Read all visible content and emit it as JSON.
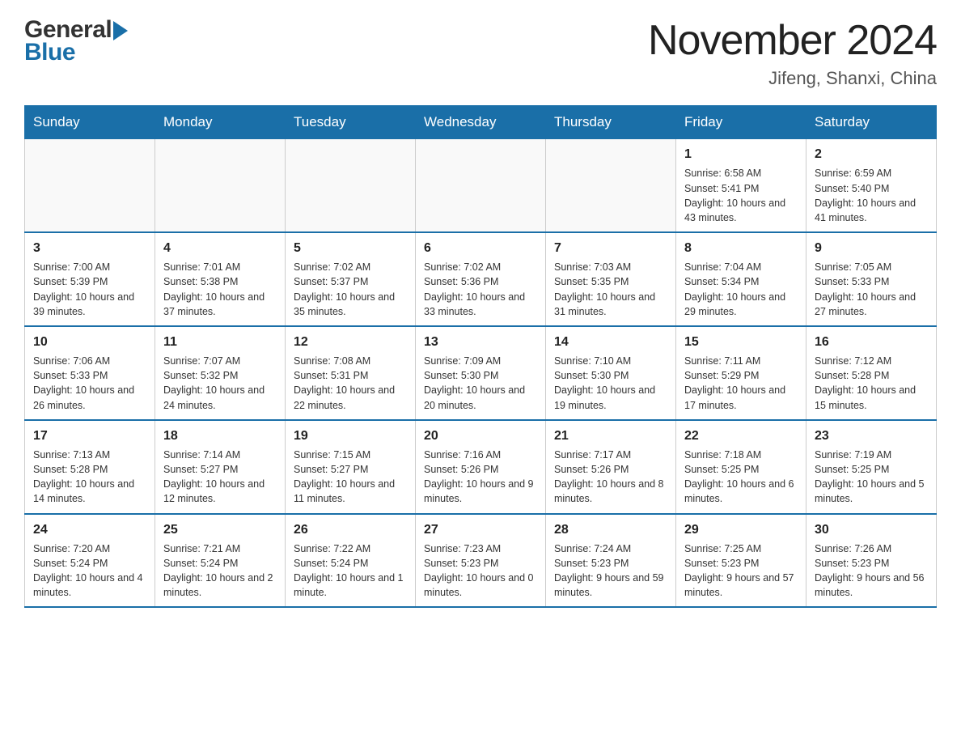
{
  "header": {
    "logo_general": "General",
    "logo_blue": "Blue",
    "month_title": "November 2024",
    "location": "Jifeng, Shanxi, China"
  },
  "weekdays": [
    "Sunday",
    "Monday",
    "Tuesday",
    "Wednesday",
    "Thursday",
    "Friday",
    "Saturday"
  ],
  "weeks": [
    [
      {
        "day": "",
        "info": ""
      },
      {
        "day": "",
        "info": ""
      },
      {
        "day": "",
        "info": ""
      },
      {
        "day": "",
        "info": ""
      },
      {
        "day": "",
        "info": ""
      },
      {
        "day": "1",
        "info": "Sunrise: 6:58 AM\nSunset: 5:41 PM\nDaylight: 10 hours and 43 minutes."
      },
      {
        "day": "2",
        "info": "Sunrise: 6:59 AM\nSunset: 5:40 PM\nDaylight: 10 hours and 41 minutes."
      }
    ],
    [
      {
        "day": "3",
        "info": "Sunrise: 7:00 AM\nSunset: 5:39 PM\nDaylight: 10 hours and 39 minutes."
      },
      {
        "day": "4",
        "info": "Sunrise: 7:01 AM\nSunset: 5:38 PM\nDaylight: 10 hours and 37 minutes."
      },
      {
        "day": "5",
        "info": "Sunrise: 7:02 AM\nSunset: 5:37 PM\nDaylight: 10 hours and 35 minutes."
      },
      {
        "day": "6",
        "info": "Sunrise: 7:02 AM\nSunset: 5:36 PM\nDaylight: 10 hours and 33 minutes."
      },
      {
        "day": "7",
        "info": "Sunrise: 7:03 AM\nSunset: 5:35 PM\nDaylight: 10 hours and 31 minutes."
      },
      {
        "day": "8",
        "info": "Sunrise: 7:04 AM\nSunset: 5:34 PM\nDaylight: 10 hours and 29 minutes."
      },
      {
        "day": "9",
        "info": "Sunrise: 7:05 AM\nSunset: 5:33 PM\nDaylight: 10 hours and 27 minutes."
      }
    ],
    [
      {
        "day": "10",
        "info": "Sunrise: 7:06 AM\nSunset: 5:33 PM\nDaylight: 10 hours and 26 minutes."
      },
      {
        "day": "11",
        "info": "Sunrise: 7:07 AM\nSunset: 5:32 PM\nDaylight: 10 hours and 24 minutes."
      },
      {
        "day": "12",
        "info": "Sunrise: 7:08 AM\nSunset: 5:31 PM\nDaylight: 10 hours and 22 minutes."
      },
      {
        "day": "13",
        "info": "Sunrise: 7:09 AM\nSunset: 5:30 PM\nDaylight: 10 hours and 20 minutes."
      },
      {
        "day": "14",
        "info": "Sunrise: 7:10 AM\nSunset: 5:30 PM\nDaylight: 10 hours and 19 minutes."
      },
      {
        "day": "15",
        "info": "Sunrise: 7:11 AM\nSunset: 5:29 PM\nDaylight: 10 hours and 17 minutes."
      },
      {
        "day": "16",
        "info": "Sunrise: 7:12 AM\nSunset: 5:28 PM\nDaylight: 10 hours and 15 minutes."
      }
    ],
    [
      {
        "day": "17",
        "info": "Sunrise: 7:13 AM\nSunset: 5:28 PM\nDaylight: 10 hours and 14 minutes."
      },
      {
        "day": "18",
        "info": "Sunrise: 7:14 AM\nSunset: 5:27 PM\nDaylight: 10 hours and 12 minutes."
      },
      {
        "day": "19",
        "info": "Sunrise: 7:15 AM\nSunset: 5:27 PM\nDaylight: 10 hours and 11 minutes."
      },
      {
        "day": "20",
        "info": "Sunrise: 7:16 AM\nSunset: 5:26 PM\nDaylight: 10 hours and 9 minutes."
      },
      {
        "day": "21",
        "info": "Sunrise: 7:17 AM\nSunset: 5:26 PM\nDaylight: 10 hours and 8 minutes."
      },
      {
        "day": "22",
        "info": "Sunrise: 7:18 AM\nSunset: 5:25 PM\nDaylight: 10 hours and 6 minutes."
      },
      {
        "day": "23",
        "info": "Sunrise: 7:19 AM\nSunset: 5:25 PM\nDaylight: 10 hours and 5 minutes."
      }
    ],
    [
      {
        "day": "24",
        "info": "Sunrise: 7:20 AM\nSunset: 5:24 PM\nDaylight: 10 hours and 4 minutes."
      },
      {
        "day": "25",
        "info": "Sunrise: 7:21 AM\nSunset: 5:24 PM\nDaylight: 10 hours and 2 minutes."
      },
      {
        "day": "26",
        "info": "Sunrise: 7:22 AM\nSunset: 5:24 PM\nDaylight: 10 hours and 1 minute."
      },
      {
        "day": "27",
        "info": "Sunrise: 7:23 AM\nSunset: 5:23 PM\nDaylight: 10 hours and 0 minutes."
      },
      {
        "day": "28",
        "info": "Sunrise: 7:24 AM\nSunset: 5:23 PM\nDaylight: 9 hours and 59 minutes."
      },
      {
        "day": "29",
        "info": "Sunrise: 7:25 AM\nSunset: 5:23 PM\nDaylight: 9 hours and 57 minutes."
      },
      {
        "day": "30",
        "info": "Sunrise: 7:26 AM\nSunset: 5:23 PM\nDaylight: 9 hours and 56 minutes."
      }
    ]
  ]
}
